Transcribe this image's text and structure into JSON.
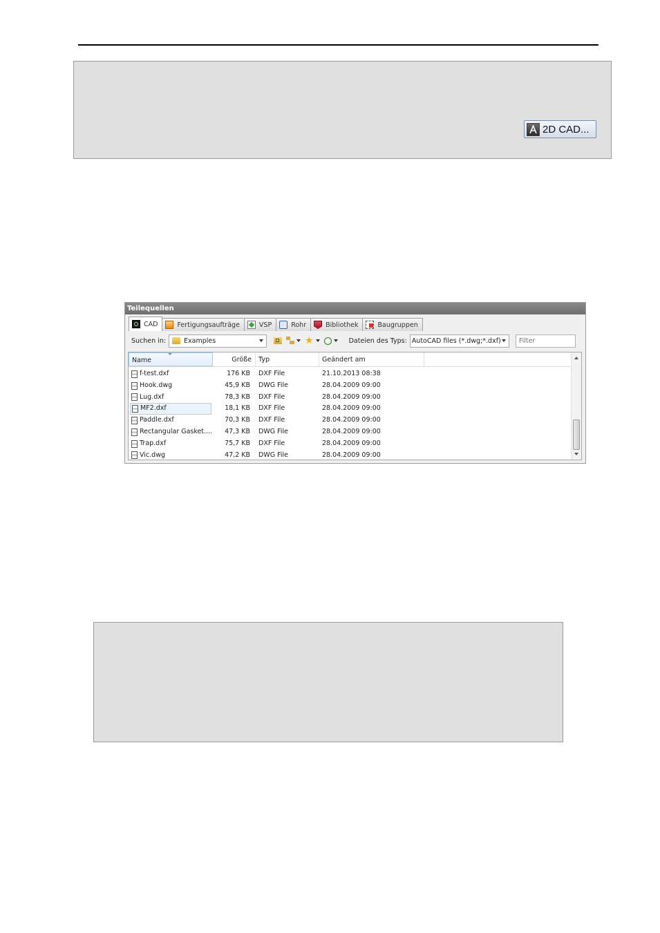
{
  "top_box": {
    "button_label": "2D CAD..."
  },
  "panel": {
    "title": "Teilequellen",
    "tabs": [
      {
        "label": "CAD",
        "active": true,
        "icon": "cad-icon"
      },
      {
        "label": "Fertigungsaufträge",
        "icon": "orders-icon"
      },
      {
        "label": "VSP",
        "icon": "vsp-icon"
      },
      {
        "label": "Rohr",
        "icon": "tube-icon"
      },
      {
        "label": "Bibliothek",
        "icon": "library-icon"
      },
      {
        "label": "Baugruppen",
        "icon": "assembly-icon"
      }
    ],
    "toolbar": {
      "search_label": "Suchen in:",
      "search_value": "Examples",
      "filetype_label": "Dateien des Typs:",
      "filetype_value": "AutoCAD files (*.dwg;*.dxf)",
      "filter_placeholder": "Filter"
    },
    "columns": {
      "name": "Name",
      "size": "Größe",
      "type": "Typ",
      "date": "Geändert am"
    },
    "files": [
      {
        "name": "f-test.dxf",
        "size": "176 KB",
        "type": "DXF File",
        "date": "21.10.2013 08:38"
      },
      {
        "name": "Hook.dwg",
        "size": "45,9 KB",
        "type": "DWG File",
        "date": "28.04.2009 09:00"
      },
      {
        "name": "Lug.dxf",
        "size": "78,3 KB",
        "type": "DXF File",
        "date": "28.04.2009 09:00"
      },
      {
        "name": "MF2.dxf",
        "size": "18,1 KB",
        "type": "DXF File",
        "date": "28.04.2009 09:00",
        "selected": true
      },
      {
        "name": "Paddle.dxf",
        "size": "70,3 KB",
        "type": "DXF File",
        "date": "28.04.2009 09:00"
      },
      {
        "name": "Rectangular Gasket....",
        "size": "47,3 KB",
        "type": "DWG File",
        "date": "28.04.2009 09:00"
      },
      {
        "name": "Trap.dxf",
        "size": "75,7 KB",
        "type": "DXF File",
        "date": "28.04.2009 09:00"
      },
      {
        "name": "Vic.dwg",
        "size": "47,2 KB",
        "type": "DWG File",
        "date": "28.04.2009 09:00"
      }
    ]
  }
}
